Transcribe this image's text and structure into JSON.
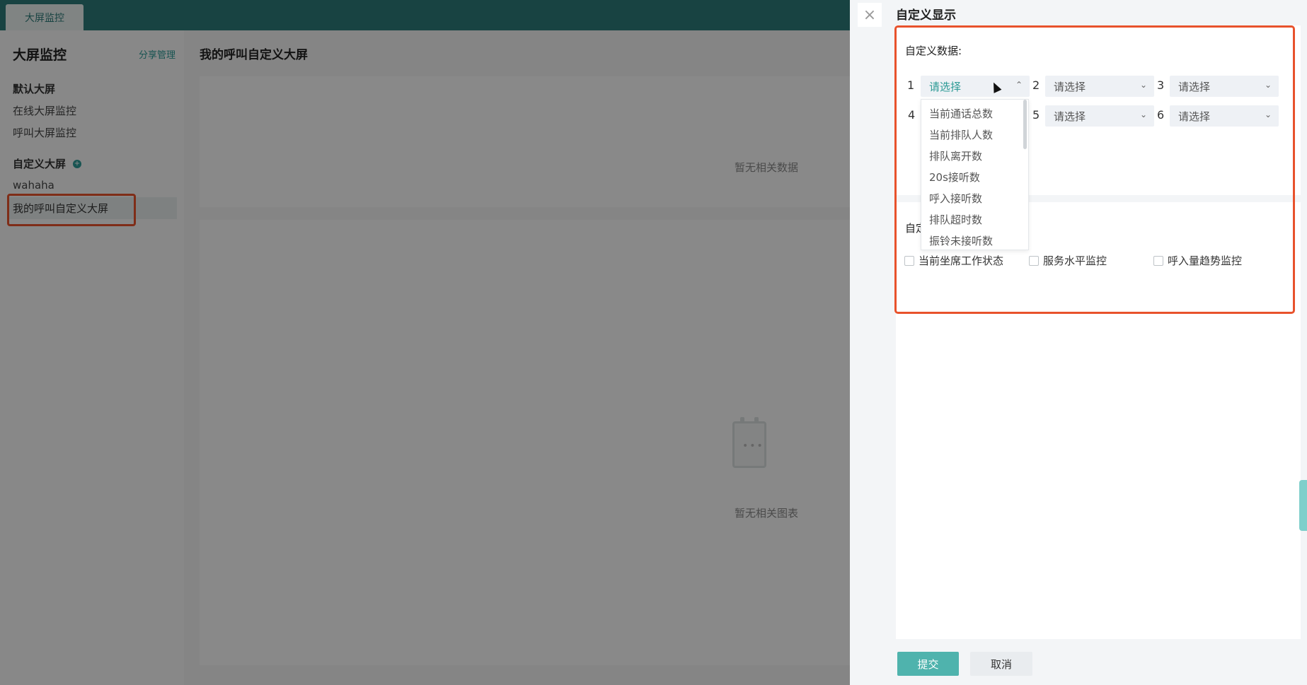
{
  "topbar": {
    "tab_label": "大屏监控"
  },
  "sidebar": {
    "title": "大屏监控",
    "share_link": "分享管理",
    "default_section": "默认大屏",
    "default_items": [
      "在线大屏监控",
      "呼叫大屏监控"
    ],
    "custom_section": "自定义大屏",
    "add_icon": "+",
    "custom_items": [
      "wahaha",
      "我的呼叫自定义大屏"
    ]
  },
  "main": {
    "title": "我的呼叫自定义大屏",
    "empty_data": "暂无相关数据",
    "empty_chart": "暂无相关图表",
    "empty_icon": "calendar-empty-icon"
  },
  "panel": {
    "close_icon": "×",
    "title": "自定义显示",
    "data_section_label": "自定义数据:",
    "selects": [
      {
        "num": "1",
        "placeholder": "请选择"
      },
      {
        "num": "2",
        "placeholder": "请选择"
      },
      {
        "num": "3",
        "placeholder": "请选择"
      },
      {
        "num": "4",
        "placeholder": "请选择"
      },
      {
        "num": "5",
        "placeholder": "请选择"
      },
      {
        "num": "6",
        "placeholder": "请选择"
      }
    ],
    "chevron_up": "⌃",
    "chevron_down": "⌄",
    "dropdown_options": [
      "当前通话总数",
      "当前排队人数",
      "排队离开数",
      "20s接听数",
      "呼入接听数",
      "排队超时数",
      "振铃未接听数"
    ],
    "chart_section_label": "自定",
    "checkboxes": [
      "当前坐席工作状态",
      "服务水平监控",
      "呼入量趋势监控"
    ],
    "submit_label": "提交",
    "cancel_label": "取消"
  },
  "colors": {
    "accent": "#2c9a95",
    "topbar": "#2c7a78",
    "highlight": "#e8522c",
    "submit": "#4fb3ad"
  }
}
